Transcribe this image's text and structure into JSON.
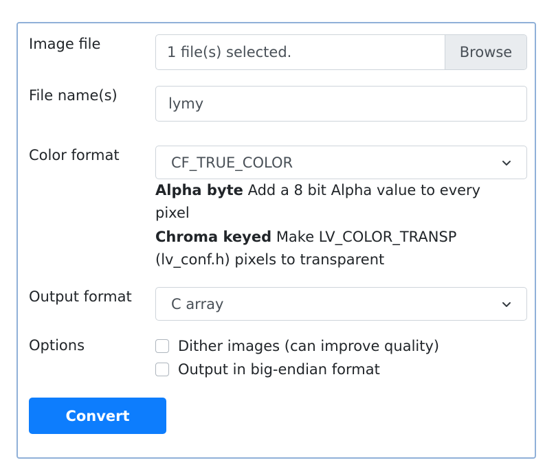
{
  "form": {
    "image_file": {
      "label": "Image file",
      "status": "1 file(s) selected.",
      "browse_label": "Browse"
    },
    "file_names": {
      "label": "File name(s)",
      "value": "lymy"
    },
    "color_format": {
      "label": "Color format",
      "selected": "CF_TRUE_COLOR",
      "help": [
        {
          "term": "Alpha byte",
          "desc": "Add a 8 bit Alpha value to every",
          "desc_cont": "pixel"
        },
        {
          "term": "Chroma keyed",
          "desc": "Make LV_COLOR_TRANSP",
          "desc_cont": "(lv_conf.h) pixels to transparent"
        }
      ]
    },
    "output_format": {
      "label": "Output format",
      "selected": "C array"
    },
    "options": {
      "label": "Options",
      "items": [
        {
          "label": "Dither images (can improve quality)",
          "checked": false
        },
        {
          "label": "Output in big-endian format",
          "checked": false
        }
      ]
    },
    "convert_label": "Convert"
  },
  "colors": {
    "primary": "#0d7dfd",
    "card_border": "#8fb0d8",
    "input_border": "#ced4da",
    "browse_bg": "#e9ecef"
  },
  "icons": {
    "select_arrow": "chevron-down-icon"
  }
}
